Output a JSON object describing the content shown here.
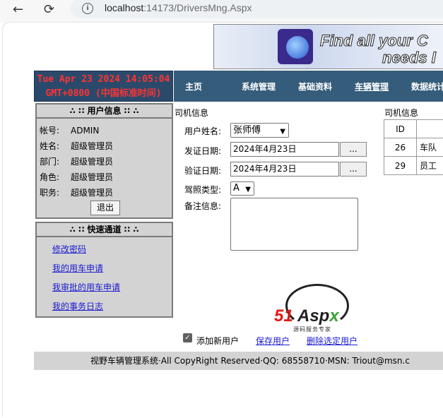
{
  "browser": {
    "back_glyph": "←",
    "reload_glyph": "⟳",
    "url_host": "localhost",
    "url_path": ":14173/DriversMng.Aspx"
  },
  "banner": {
    "line1": "Find all your C",
    "line2": "needs I"
  },
  "clock": {
    "line1": "Tue Apr 23 2024 14:05:04",
    "line2": "GMT+0800 (中国标准时间)"
  },
  "nav": {
    "items": [
      "主页",
      "系统管理",
      "基础资料",
      "车辆管理",
      "数据统计"
    ]
  },
  "user_panel": {
    "title": "∴ ∷ 用户信息 ∷ ∴",
    "rows": [
      {
        "label": "帐号:",
        "value": "ADMIN"
      },
      {
        "label": "姓名:",
        "value": "超级管理员"
      },
      {
        "label": "部门:",
        "value": "超级管理员"
      },
      {
        "label": "角色:",
        "value": "超级管理员"
      },
      {
        "label": "职务:",
        "value": "超级管理员"
      }
    ],
    "logout_label": "退出"
  },
  "quick_panel": {
    "title": "∴ ∷ 快速通道 ∷ ∴",
    "links": [
      "修改密码",
      "我的用车申请",
      "我审批的用车申请",
      "我的事务日志"
    ]
  },
  "form": {
    "section_title": "司机信息",
    "username_label": "用户姓名:",
    "username_value": "张师傅",
    "issue_date_label": "发证日期:",
    "issue_date_value": "2024年4月23日",
    "verify_date_label": "验证日期:",
    "verify_date_value": "2024年4月23日",
    "picker_label": "...",
    "license_label": "驾照类型:",
    "license_value": "A",
    "note_label": "备注信息:",
    "note_value": ""
  },
  "driver_list": {
    "title": "司机信息",
    "header": [
      "ID",
      ""
    ],
    "rows": [
      [
        "26",
        "车队"
      ],
      [
        "29",
        "员工"
      ]
    ]
  },
  "logo": {
    "part1": "51",
    "part2": "Asp",
    "part3": "x",
    "subtitle": "源码服务专家"
  },
  "actions": {
    "add_new_label": "添加新用户",
    "add_new_checked": true,
    "save_label": "保存用户",
    "delete_label": "删除选定用户"
  },
  "footer": {
    "text": "视野车辆管理系统·All CopyRight Reserved·QQ: 68558710·MSN: Triout@msn.c"
  },
  "colors": {
    "nav_bg": "#355c7a",
    "clock_text": "#ff3333",
    "panel_bg": "#d3d3d3",
    "link": "#1a1ad0"
  }
}
